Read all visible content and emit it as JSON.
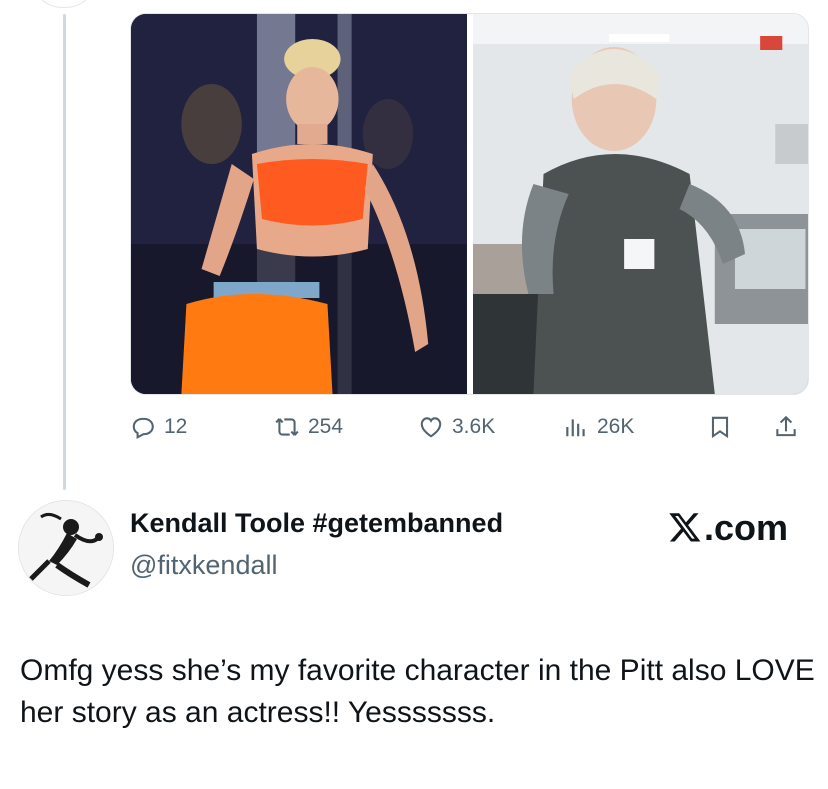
{
  "media": {
    "left_image": "woman-fitness-instructor-orange-outfit",
    "right_image": "nurse-in-scrubs-hospital"
  },
  "actions": {
    "replies": "12",
    "reposts": "254",
    "likes": "3.6K",
    "views": "26K"
  },
  "icons": [
    "reply-icon",
    "repost-icon",
    "like-icon",
    "views-icon",
    "bookmark-icon",
    "share-icon",
    "x-logo-icon"
  ],
  "author": {
    "name": "Kendall Toole #getembanned",
    "handle": "@fitxkendall",
    "brand": ".com"
  },
  "tweet": {
    "text": "Omfg yess she’s my favorite character in the Pitt also LOVE her story as an actress!! Yesssssss."
  },
  "colors": {
    "text": "#0f1419",
    "secondary": "#536471",
    "thread_line": "#cfd9de"
  }
}
